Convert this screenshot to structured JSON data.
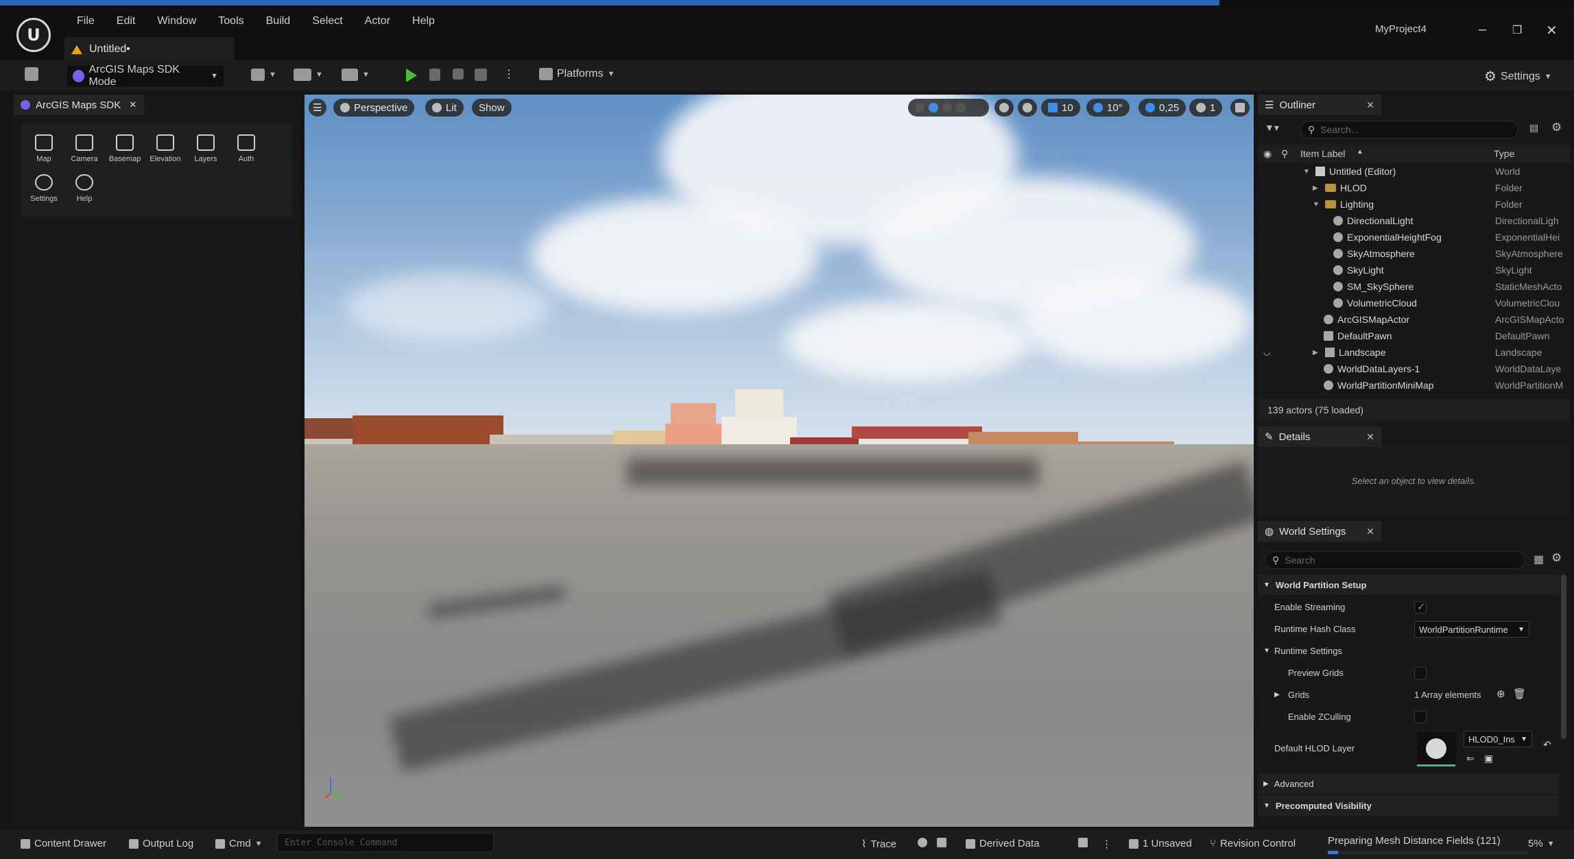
{
  "app": {
    "menu": [
      "File",
      "Edit",
      "Window",
      "Tools",
      "Build",
      "Select",
      "Actor",
      "Help"
    ],
    "doc_tab": "Untitled•",
    "project_name": "MyProject4"
  },
  "toolbar": {
    "mode_label": "ArcGIS Maps SDK Mode",
    "platforms_label": "Platforms",
    "settings_label": "Settings"
  },
  "left_panel": {
    "tab_label": "ArcGIS Maps SDK",
    "tools": [
      "Map",
      "Camera",
      "Basemap",
      "Elevation",
      "Layers",
      "Auth",
      "Settings",
      "Help"
    ]
  },
  "viewport": {
    "perspective_label": "Perspective",
    "lit_label": "Lit",
    "show_label": "Show",
    "grid_snap": "10",
    "rot_snap": "10°",
    "scale_snap": "0,25",
    "camera_speed": "1"
  },
  "outliner": {
    "tab_label": "Outliner",
    "search_placeholder": "Search...",
    "col_label": "Item Label",
    "col_type": "Type",
    "rows": [
      {
        "label": "Untitled (Editor)",
        "type": "World"
      },
      {
        "label": "HLOD",
        "type": "Folder"
      },
      {
        "label": "Lighting",
        "type": "Folder"
      },
      {
        "label": "DirectionalLight",
        "type": "DirectionalLigh"
      },
      {
        "label": "ExponentialHeightFog",
        "type": "ExponentialHei"
      },
      {
        "label": "SkyAtmosphere",
        "type": "SkyAtmosphere"
      },
      {
        "label": "SkyLight",
        "type": "SkyLight"
      },
      {
        "label": "SM_SkySphere",
        "type": "StaticMeshActo"
      },
      {
        "label": "VolumetricCloud",
        "type": "VolumetricClou"
      },
      {
        "label": "ArcGISMapActor",
        "type": "ArcGISMapActo"
      },
      {
        "label": "DefaultPawn",
        "type": "DefaultPawn"
      },
      {
        "label": "Landscape",
        "type": "Landscape"
      },
      {
        "label": "WorldDataLayers-1",
        "type": "WorldDataLaye"
      },
      {
        "label": "WorldPartitionMiniMap",
        "type": "WorldPartitionM"
      }
    ],
    "actor_count": "139 actors (75 loaded)"
  },
  "details": {
    "tab_label": "Details",
    "empty_text": "Select an object to view details."
  },
  "world_settings": {
    "tab_label": "World Settings",
    "search_placeholder": "Search",
    "section_wp": "World Partition Setup",
    "enable_streaming": "Enable Streaming",
    "runtime_hash_class": "Runtime Hash Class",
    "runtime_hash_value": "WorldPartitionRuntime",
    "section_runtime": "Runtime Settings",
    "preview_grids": "Preview Grids",
    "grids": "Grids",
    "grids_value": "1 Array elements",
    "enable_zculling": "Enable ZCulling",
    "default_hlod": "Default HLOD Layer",
    "hlod_value": "HLOD0_Ins",
    "section_advanced": "Advanced",
    "section_precomputed": "Precomputed Visibility"
  },
  "statusbar": {
    "content_drawer": "Content Drawer",
    "output_log": "Output Log",
    "cmd": "Cmd",
    "console_placeholder": "Enter Console Command",
    "trace": "Trace",
    "derived_data": "Derived Data",
    "unsaved": "1 Unsaved",
    "revision_control": "Revision Control",
    "task": "Preparing Mesh Distance Fields (121)",
    "task_percent": "5%",
    "task_progress": 0.05
  }
}
